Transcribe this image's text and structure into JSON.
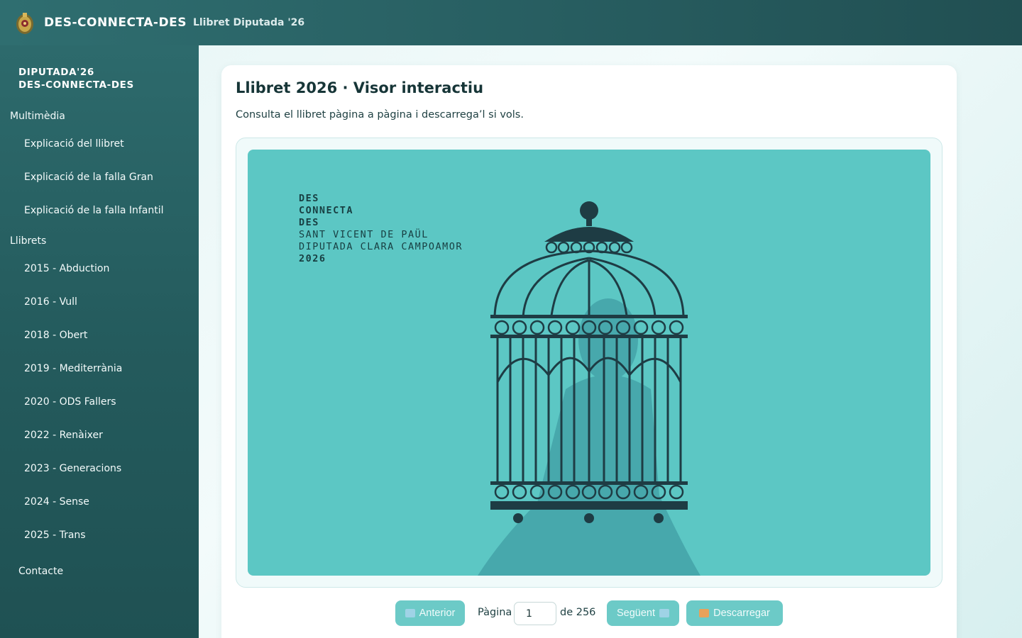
{
  "header": {
    "title": "DES-CONNECTA-DES",
    "subtitle": "Llibret Diputada '26"
  },
  "sidebar": {
    "brand_line1": "DIPUTADA'26",
    "brand_line2": "DES-CONNECTA-DES",
    "multimedia_label": "Multimèdia",
    "multimedia_items": [
      {
        "label": "Explicació del llibret"
      },
      {
        "label": "Explicació de la falla Gran"
      },
      {
        "label": "Explicació de la falla Infantil"
      }
    ],
    "llibrets_label": "Llibrets",
    "llibrets_items": [
      {
        "label": "2015 - Abduction"
      },
      {
        "label": "2016 - Vull"
      },
      {
        "label": "2018 - Obert"
      },
      {
        "label": "2019 - Mediterrània"
      },
      {
        "label": "2020 - ODS Fallers"
      },
      {
        "label": "2022 - Renàixer"
      },
      {
        "label": "2023 - Generacions"
      },
      {
        "label": "2024 - Sense"
      },
      {
        "label": "2025 - Trans"
      }
    ],
    "contact_label": "Contacte"
  },
  "main": {
    "title": "Llibret 2026 · Visor interactiu",
    "description": "Consulta el llibret pàgina a pàgina i descarrega’l si vols.",
    "cover": {
      "line1": "DES",
      "line2": "CONNECTA",
      "line3": "DES",
      "line4": "SANT VICENT DE PAÜL",
      "line5": "DIPUTADA CLARA CAMPOAMOR",
      "line6": "2026"
    },
    "controls": {
      "prev_label": "Anterior",
      "page_label": "Pàgina",
      "page_value": "1",
      "of_label": "de 256",
      "next_label": "Següent",
      "download_label": "Descarregar"
    }
  },
  "colors": {
    "header": "#285f62",
    "sidebar": "#245b5d",
    "cover_bg": "#5cc7c4",
    "cage": "#1e3c44",
    "button": "#6ccac7"
  }
}
